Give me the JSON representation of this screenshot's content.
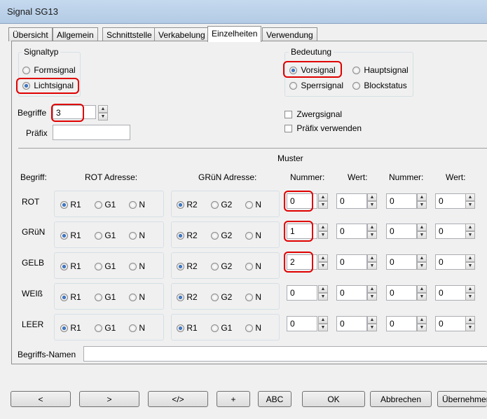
{
  "window": {
    "title": "Signal SG13"
  },
  "tabs": [
    "Übersicht",
    "Allgemein",
    "Schnittstelle",
    "Verkabelung",
    "Einzelheiten",
    "Verwendung"
  ],
  "active_tab": "Einzelheiten",
  "signaltyp": {
    "label": "Signaltyp",
    "options": [
      {
        "label": "Formsignal",
        "selected": false
      },
      {
        "label": "Lichtsignal",
        "selected": true
      }
    ]
  },
  "bedeutung": {
    "label": "Bedeutung",
    "options": [
      {
        "label": "Vorsignal",
        "selected": true
      },
      {
        "label": "Hauptsignal",
        "selected": false
      },
      {
        "label": "Sperrsignal",
        "selected": false
      },
      {
        "label": "Blockstatus",
        "selected": false
      }
    ]
  },
  "begriffe": {
    "label": "Begriffe",
    "value": "3"
  },
  "praefix": {
    "label": "Präfix",
    "value": ""
  },
  "checkboxes": {
    "zwergsignal": {
      "label": "Zwergsignal",
      "checked": false
    },
    "praefix_verwenden": {
      "label": "Präfix verwenden",
      "checked": false
    }
  },
  "muster": {
    "title": "Muster",
    "headers": {
      "begriff": "Begriff:",
      "rot_adresse": "ROT Adresse:",
      "gruen_adresse": "GRüN Adresse:",
      "nummer1": "Nummer:",
      "wert1": "Wert:",
      "nummer2": "Nummer:",
      "wert2": "Wert:"
    },
    "rows": [
      {
        "name": "ROT",
        "rot": [
          "R1",
          "G1",
          "N"
        ],
        "rot_sel": 0,
        "gruen": [
          "R2",
          "G2",
          "N"
        ],
        "gruen_sel": 0,
        "nummer1": "0",
        "wert1": "0",
        "nummer2": "0",
        "wert2": "0"
      },
      {
        "name": "GRüN",
        "rot": [
          "R1",
          "G1",
          "N"
        ],
        "rot_sel": 0,
        "gruen": [
          "R2",
          "G2",
          "N"
        ],
        "gruen_sel": 0,
        "nummer1": "1",
        "wert1": "0",
        "nummer2": "0",
        "wert2": "0"
      },
      {
        "name": "GELB",
        "rot": [
          "R1",
          "G1",
          "N"
        ],
        "rot_sel": 0,
        "gruen": [
          "R2",
          "G2",
          "N"
        ],
        "gruen_sel": 0,
        "nummer1": "2",
        "wert1": "0",
        "nummer2": "0",
        "wert2": "0"
      },
      {
        "name": "WEIß",
        "rot": [
          "R1",
          "G1",
          "N"
        ],
        "rot_sel": 0,
        "gruen": [
          "R2",
          "G2",
          "N"
        ],
        "gruen_sel": 0,
        "nummer1": "0",
        "wert1": "0",
        "nummer2": "0",
        "wert2": "0"
      },
      {
        "name": "LEER",
        "rot": [
          "R1",
          "G1",
          "N"
        ],
        "rot_sel": 0,
        "gruen": [
          "R1",
          "G1",
          "N"
        ],
        "gruen_sel": 0,
        "nummer1": "0",
        "wert1": "0",
        "nummer2": "0",
        "wert2": "0"
      }
    ]
  },
  "begriffs_namen": {
    "label": "Begriffs-Namen",
    "value": ""
  },
  "buttons": [
    "<",
    ">",
    "</>",
    "+",
    "ABC",
    "OK",
    "Abbrechen",
    "Übernehmen"
  ],
  "colors": {
    "highlight": "#e00000",
    "titlebar": "#c5d9ee",
    "panel": "#f0f0f0"
  }
}
